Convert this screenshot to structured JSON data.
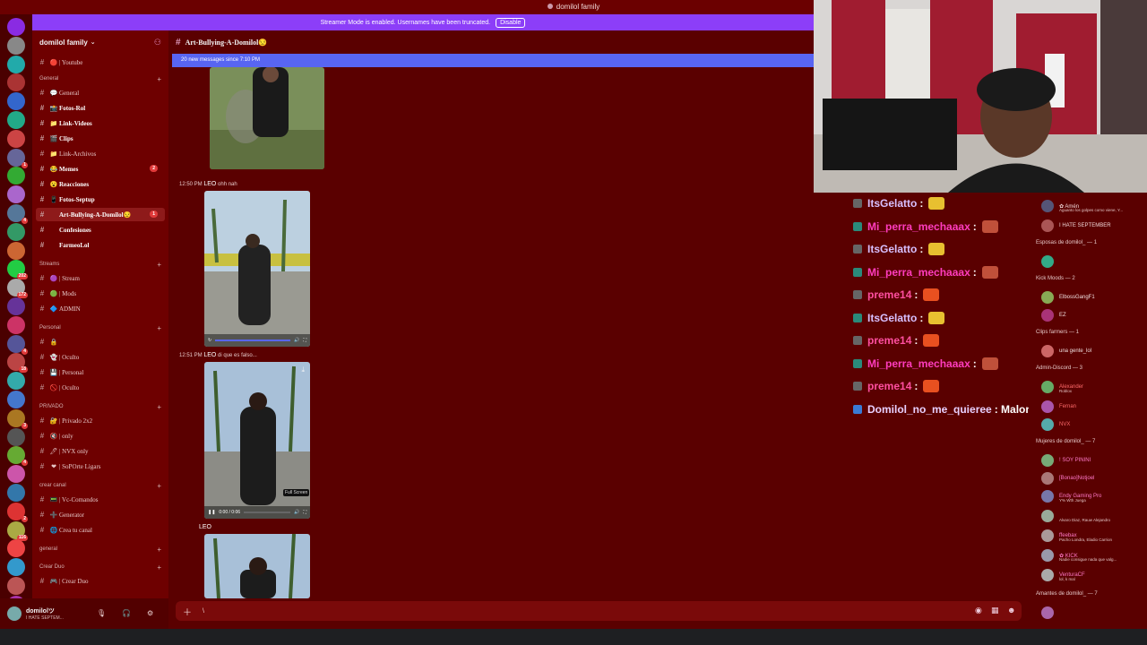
{
  "window": {
    "title": "domilol family"
  },
  "streamer_banner": {
    "text": "Streamer Mode is enabled. Usernames have been truncated.",
    "button": "Disable"
  },
  "servers": {
    "rail_colors": [
      "#8a2be2",
      "#888",
      "#2aa",
      "#a33",
      "#36c",
      "#2a8",
      "#c44",
      "#669",
      "#3a3",
      "#a6c",
      "#579",
      "#396",
      "#c63",
      "#2c4",
      "#aaa",
      "#639",
      "#c36",
      "#559",
      "#b44",
      "#3aa",
      "#47c",
      "#a72",
      "#555",
      "#6a3",
      "#c5a",
      "#37a",
      "#d33",
      "#aa4",
      "#e44",
      "#39c",
      "#b55",
      "#a3a",
      "#c33"
    ],
    "badges": [
      {
        "index": 7,
        "text": "1"
      },
      {
        "index": 10,
        "text": "4"
      },
      {
        "index": 13,
        "text": "202"
      },
      {
        "index": 14,
        "text": "172"
      },
      {
        "index": 17,
        "text": "4"
      },
      {
        "index": 18,
        "text": "18"
      },
      {
        "index": 21,
        "text": "3"
      },
      {
        "index": 23,
        "text": "4"
      },
      {
        "index": 26,
        "text": "2"
      },
      {
        "index": 27,
        "text": "116"
      },
      {
        "index": 31,
        "text": "NEW"
      }
    ]
  },
  "sidebar": {
    "server_name": "domilol family",
    "channels_top": [
      {
        "label": "| Youtube",
        "emoji": "🔴"
      }
    ],
    "categories": [
      {
        "name": "General",
        "items": [
          {
            "label": "General",
            "emoji": "💬",
            "active": false,
            "bold": false
          },
          {
            "label": "Fotos-Rol",
            "emoji": "📸",
            "active": false,
            "bold": true
          },
          {
            "label": "Link-Videos",
            "emoji": "📁",
            "active": false,
            "bold": true
          },
          {
            "label": "Clips",
            "emoji": "🎬",
            "active": false,
            "bold": true
          },
          {
            "label": "Link-Archivos",
            "emoji": "📁",
            "active": false,
            "bold": false
          },
          {
            "label": "Memes",
            "emoji": "😂",
            "active": false,
            "bold": true,
            "count": "2"
          },
          {
            "label": "Reacciones",
            "emoji": "😮",
            "active": false,
            "bold": true
          },
          {
            "label": "Fotos-Septup",
            "emoji": "📱",
            "active": false,
            "bold": true
          },
          {
            "label": "Art-Bullying-A-Domilol😒",
            "emoji": "",
            "active": true,
            "bold": true,
            "count": "1"
          },
          {
            "label": "Confesiones",
            "emoji": "",
            "active": false,
            "bold": true
          },
          {
            "label": "FarmeoLol",
            "emoji": "",
            "active": false,
            "bold": true
          }
        ]
      },
      {
        "name": "Streams",
        "items": [
          {
            "label": "| Stream",
            "emoji": "🟣"
          },
          {
            "label": "| Mods",
            "emoji": "🟢"
          },
          {
            "label": "ADMIN",
            "emoji": "🔷"
          }
        ]
      },
      {
        "name": "Personal",
        "items": [
          {
            "label": "",
            "emoji": "🔒"
          },
          {
            "label": "| Oculto",
            "emoji": "👻"
          },
          {
            "label": "| Personal",
            "emoji": "💾"
          },
          {
            "label": "| Oculto",
            "emoji": "🚫"
          }
        ]
      },
      {
        "name": "PRIVADO",
        "items": [
          {
            "label": "| Privado 2x2",
            "emoji": "🔐"
          },
          {
            "label": "| only",
            "emoji": "🔇"
          },
          {
            "label": "| NVX only",
            "emoji": "🖊"
          },
          {
            "label": "| SoPOrte Ligars",
            "emoji": "❤"
          }
        ]
      },
      {
        "name": "crear canal",
        "items": [
          {
            "label": "| Vc-Comandos",
            "emoji": "📟"
          },
          {
            "label": "Generator",
            "emoji": "➕"
          },
          {
            "label": "Crea tu canal",
            "emoji": "🌐"
          }
        ]
      },
      {
        "name": "general",
        "items": []
      },
      {
        "name": "Crear Duo",
        "items": [
          {
            "label": "| Crear Duo",
            "emoji": "🎮"
          }
        ]
      }
    ]
  },
  "user": {
    "name": "domilolツ",
    "status": "I HATE SEPTEM..."
  },
  "chat": {
    "channel": "Art-Bullying-A-Domilol😒",
    "new_messages": "20 new messages since 7:10 PM",
    "messages": [
      {
        "time": "12:50 PM",
        "author": "LEO",
        "text": "ohh nah"
      },
      {
        "time": "12:51 PM",
        "author": "LEO",
        "text": "di que es falso..."
      },
      {
        "time": "",
        "author": "LEO",
        "text": ""
      }
    ],
    "video": {
      "time": "0:00 / 0:06",
      "tooltip": "Full Screen"
    },
    "composer_text": "\\"
  },
  "twitch_chat": [
    {
      "user": "ItsGelatto",
      "color": "#d8c0ff",
      "msg": ":"
    },
    {
      "user": "Mi_perra_mechaaax",
      "color": "#ff3cbe",
      "msg": ":"
    },
    {
      "user": "ItsGelatto",
      "color": "#d8c0ff",
      "msg": ":"
    },
    {
      "user": "Mi_perra_mechaaax",
      "color": "#ff3cbe",
      "msg": ":"
    },
    {
      "user": "preme14",
      "color": "#ff4fa0",
      "msg": ":"
    },
    {
      "user": "ItsGelatto",
      "color": "#d8c0ff",
      "msg": ":"
    },
    {
      "user": "preme14",
      "color": "#ff4fa0",
      "msg": ":"
    },
    {
      "user": "Mi_perra_mechaaax",
      "color": "#ff3cbe",
      "msg": ":"
    },
    {
      "user": "preme14",
      "color": "#ff4fa0",
      "msg": ":"
    },
    {
      "user": "Domilol_no_me_quieree",
      "color": "#e8d0ff",
      "msg": ": Malona"
    }
  ],
  "members": {
    "rows": [
      {
        "type": "row",
        "name": "✿ Amén",
        "sub": "Aguanto los golpes como viene, Y...",
        "color": "#f0d8d8"
      },
      {
        "type": "row",
        "name": "I HATE SEPTEMBER",
        "sub": "",
        "color": "#f0d8d8"
      },
      {
        "type": "head",
        "text": "Esposas de domilol_ — 1"
      },
      {
        "type": "row",
        "name": "",
        "sub": "",
        "color": "#ff4fd0"
      },
      {
        "type": "head",
        "text": "Kick Moods — 2"
      },
      {
        "type": "row",
        "name": "ElbossGangF1",
        "sub": "",
        "color": "#f0e0e0"
      },
      {
        "type": "row",
        "name": "EZ",
        "sub": "",
        "color": "#f0e0e0"
      },
      {
        "type": "head",
        "text": "Clips farmers — 1"
      },
      {
        "type": "row",
        "name": "una gente_lol",
        "sub": "",
        "color": "#f0e0e0"
      },
      {
        "type": "head",
        "text": "Admin-Discord — 3"
      },
      {
        "type": "row",
        "name": "Alexander",
        "sub": "Roblox",
        "color": "#ff6a6a"
      },
      {
        "type": "row",
        "name": "Fernan",
        "sub": "",
        "color": "#ff6a6a"
      },
      {
        "type": "row",
        "name": "NVX",
        "sub": "",
        "color": "#ff6a6a"
      },
      {
        "type": "head",
        "text": "Mujeres de domilol_ — 7"
      },
      {
        "type": "row",
        "name": "! SOY PININI",
        "sub": "",
        "color": "#ff78c8"
      },
      {
        "type": "row",
        "name": "[Bonao]Notjoel",
        "sub": "",
        "color": "#ff78c8"
      },
      {
        "type": "row",
        "name": "Endy Gaming Pro",
        "sub": "Y% Wth Juega",
        "color": "#ff78c8"
      },
      {
        "type": "row",
        "name": "",
        "sub": "Alvaro Diaz, Rauw Alejandro",
        "color": "#ff78c8"
      },
      {
        "type": "row",
        "name": "ffeebax",
        "sub": "Pacho Londra, Eladio Carrion",
        "color": "#ff78c8"
      },
      {
        "type": "row",
        "name": "✿ KICK",
        "sub": "Nadie consigue nada que valg...",
        "color": "#ff78c8"
      },
      {
        "type": "row",
        "name": "VenturaCF",
        "sub": "lol, k mal",
        "color": "#ff78c8"
      },
      {
        "type": "head",
        "text": "Amantes de domilol_ — 7"
      },
      {
        "type": "row",
        "name": "",
        "sub": "",
        "color": "#ff78c8"
      }
    ]
  },
  "colors": {
    "accent": "#5865f2",
    "streamer": "#8c3ef8",
    "bg": "#5a0000"
  }
}
